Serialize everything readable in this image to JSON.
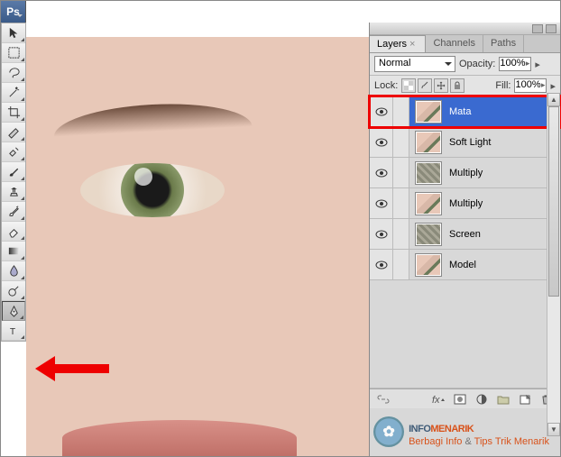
{
  "app": {
    "short_name": "Ps"
  },
  "toolbar": {
    "tools": [
      {
        "name": "move-tool"
      },
      {
        "name": "marquee-tool"
      },
      {
        "name": "lasso-tool"
      },
      {
        "name": "magic-wand-tool"
      },
      {
        "name": "crop-tool"
      },
      {
        "name": "slice-tool"
      },
      {
        "name": "healing-brush-tool"
      },
      {
        "name": "brush-tool"
      },
      {
        "name": "clone-stamp-tool"
      },
      {
        "name": "history-brush-tool"
      },
      {
        "name": "eraser-tool"
      },
      {
        "name": "gradient-tool"
      },
      {
        "name": "blur-tool"
      },
      {
        "name": "dodge-tool"
      },
      {
        "name": "pen-tool",
        "selected": true
      },
      {
        "name": "type-tool"
      }
    ]
  },
  "panel": {
    "tabs": [
      {
        "label": "Layers",
        "active": true
      },
      {
        "label": "Channels",
        "active": false
      },
      {
        "label": "Paths",
        "active": false
      }
    ],
    "blend_mode": "Normal",
    "opacity_label": "Opacity:",
    "opacity_value": "100%",
    "lock_label": "Lock:",
    "fill_label": "Fill:",
    "fill_value": "100%",
    "layers": [
      {
        "name": "Mata",
        "visible": true,
        "selected": true,
        "thumb": "face"
      },
      {
        "name": "Soft Light",
        "visible": true,
        "selected": false,
        "thumb": "face"
      },
      {
        "name": "Multiply",
        "visible": true,
        "selected": false,
        "thumb": "texture"
      },
      {
        "name": "Multiply",
        "visible": true,
        "selected": false,
        "thumb": "face"
      },
      {
        "name": "Screen",
        "visible": true,
        "selected": false,
        "thumb": "texture"
      },
      {
        "name": "Model",
        "visible": true,
        "selected": false,
        "thumb": "face"
      }
    ]
  },
  "watermark": {
    "line1a": "INFO",
    "line1b": "MENARIK",
    "line2a": "Berbagi Info ",
    "line2amp": "&",
    "line2b": " Tips Trik Menarik"
  }
}
